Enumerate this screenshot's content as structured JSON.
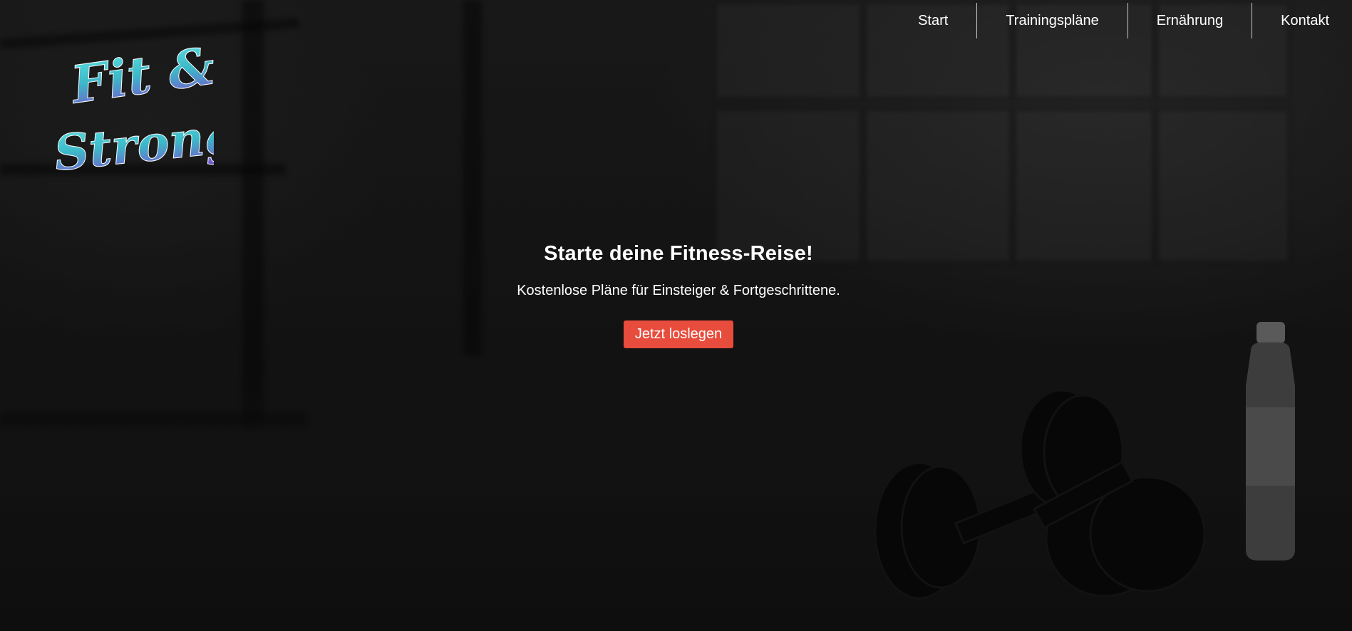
{
  "logo": {
    "line1": "Fit &",
    "line2": "Strong"
  },
  "nav": {
    "items": [
      {
        "label": "Start"
      },
      {
        "label": "Trainingspläne"
      },
      {
        "label": "Ernährung"
      },
      {
        "label": "Kontakt"
      }
    ]
  },
  "hero": {
    "title": "Starte deine Fitness-Reise!",
    "subtitle": "Kostenlose Pläne für Einsteiger & Fortgeschrittene.",
    "cta_label": "Jetzt loslegen"
  },
  "colors": {
    "cta": "#e74c3c",
    "logo_teal": "#4fd6d6",
    "logo_purple": "#7a5bd6",
    "text": "#ffffff"
  },
  "icons": [
    "dumbbell-image",
    "water-bottle-image"
  ]
}
